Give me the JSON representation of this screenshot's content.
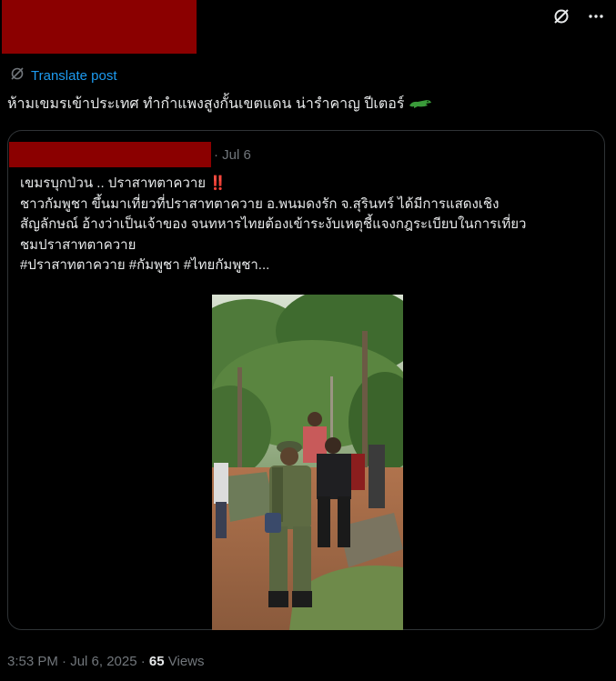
{
  "post": {
    "translate_label": "Translate post",
    "text": "ห้ามเขมรเข้าประเทศ ทำกำแพงสูงกั้นเขตแดน  น่ารำคาญ ปีเตอร์"
  },
  "quote": {
    "date": "· Jul 6",
    "headline": "เขมรบุกป่วน .. ปราสาทตาควาย",
    "emoji_bangbang": "‼️",
    "line2": "ชาวกัมพูชา ขึ้นมาเที่ยวที่ปราสาทตาควาย อ.พนมดงรัก จ.สุรินทร์ ได้มีการแสดงเชิง",
    "line3": "สัญลักษณ์ อ้างว่าเป็นเจ้าของ จนทหารไทยต้องเข้าระงับเหตุชี้แจงกฎระเบียบในการเที่ยว",
    "line4": "ชมปราสาทตาควาย",
    "hashtags": "#ปราสาทตาควาย #กัมพูชา #ไทยกัมพูชา..."
  },
  "footer": {
    "time_date": "3:53 PM · Jul 6, 2025 · ",
    "views_count": "65",
    "views_label": " Views"
  },
  "icons": {
    "grok": "grok-icon",
    "more": "more-icon",
    "translate": "translate-icon",
    "crocodile_emoji": "crocodile-emoji"
  },
  "colors": {
    "background": "#000000",
    "text": "#e7e9ea",
    "secondary": "#71767b",
    "link": "#1d9bf0",
    "border": "#2f3336",
    "redaction": "#8b0000"
  }
}
